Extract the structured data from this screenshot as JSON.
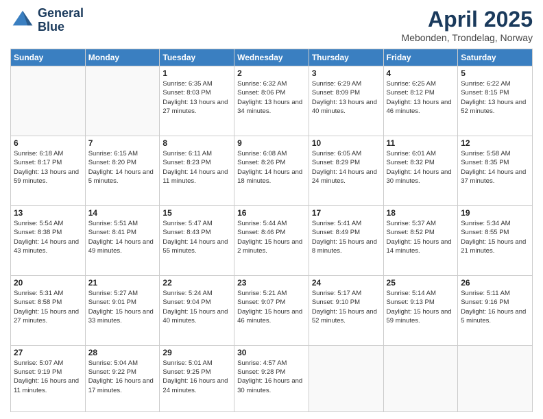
{
  "header": {
    "logo_line1": "General",
    "logo_line2": "Blue",
    "title": "April 2025",
    "subtitle": "Mebonden, Trondelag, Norway"
  },
  "days_of_week": [
    "Sunday",
    "Monday",
    "Tuesday",
    "Wednesday",
    "Thursday",
    "Friday",
    "Saturday"
  ],
  "weeks": [
    [
      {
        "day": "",
        "info": ""
      },
      {
        "day": "",
        "info": ""
      },
      {
        "day": "1",
        "info": "Sunrise: 6:35 AM\nSunset: 8:03 PM\nDaylight: 13 hours and 27 minutes."
      },
      {
        "day": "2",
        "info": "Sunrise: 6:32 AM\nSunset: 8:06 PM\nDaylight: 13 hours and 34 minutes."
      },
      {
        "day": "3",
        "info": "Sunrise: 6:29 AM\nSunset: 8:09 PM\nDaylight: 13 hours and 40 minutes."
      },
      {
        "day": "4",
        "info": "Sunrise: 6:25 AM\nSunset: 8:12 PM\nDaylight: 13 hours and 46 minutes."
      },
      {
        "day": "5",
        "info": "Sunrise: 6:22 AM\nSunset: 8:15 PM\nDaylight: 13 hours and 52 minutes."
      }
    ],
    [
      {
        "day": "6",
        "info": "Sunrise: 6:18 AM\nSunset: 8:17 PM\nDaylight: 13 hours and 59 minutes."
      },
      {
        "day": "7",
        "info": "Sunrise: 6:15 AM\nSunset: 8:20 PM\nDaylight: 14 hours and 5 minutes."
      },
      {
        "day": "8",
        "info": "Sunrise: 6:11 AM\nSunset: 8:23 PM\nDaylight: 14 hours and 11 minutes."
      },
      {
        "day": "9",
        "info": "Sunrise: 6:08 AM\nSunset: 8:26 PM\nDaylight: 14 hours and 18 minutes."
      },
      {
        "day": "10",
        "info": "Sunrise: 6:05 AM\nSunset: 8:29 PM\nDaylight: 14 hours and 24 minutes."
      },
      {
        "day": "11",
        "info": "Sunrise: 6:01 AM\nSunset: 8:32 PM\nDaylight: 14 hours and 30 minutes."
      },
      {
        "day": "12",
        "info": "Sunrise: 5:58 AM\nSunset: 8:35 PM\nDaylight: 14 hours and 37 minutes."
      }
    ],
    [
      {
        "day": "13",
        "info": "Sunrise: 5:54 AM\nSunset: 8:38 PM\nDaylight: 14 hours and 43 minutes."
      },
      {
        "day": "14",
        "info": "Sunrise: 5:51 AM\nSunset: 8:41 PM\nDaylight: 14 hours and 49 minutes."
      },
      {
        "day": "15",
        "info": "Sunrise: 5:47 AM\nSunset: 8:43 PM\nDaylight: 14 hours and 55 minutes."
      },
      {
        "day": "16",
        "info": "Sunrise: 5:44 AM\nSunset: 8:46 PM\nDaylight: 15 hours and 2 minutes."
      },
      {
        "day": "17",
        "info": "Sunrise: 5:41 AM\nSunset: 8:49 PM\nDaylight: 15 hours and 8 minutes."
      },
      {
        "day": "18",
        "info": "Sunrise: 5:37 AM\nSunset: 8:52 PM\nDaylight: 15 hours and 14 minutes."
      },
      {
        "day": "19",
        "info": "Sunrise: 5:34 AM\nSunset: 8:55 PM\nDaylight: 15 hours and 21 minutes."
      }
    ],
    [
      {
        "day": "20",
        "info": "Sunrise: 5:31 AM\nSunset: 8:58 PM\nDaylight: 15 hours and 27 minutes."
      },
      {
        "day": "21",
        "info": "Sunrise: 5:27 AM\nSunset: 9:01 PM\nDaylight: 15 hours and 33 minutes."
      },
      {
        "day": "22",
        "info": "Sunrise: 5:24 AM\nSunset: 9:04 PM\nDaylight: 15 hours and 40 minutes."
      },
      {
        "day": "23",
        "info": "Sunrise: 5:21 AM\nSunset: 9:07 PM\nDaylight: 15 hours and 46 minutes."
      },
      {
        "day": "24",
        "info": "Sunrise: 5:17 AM\nSunset: 9:10 PM\nDaylight: 15 hours and 52 minutes."
      },
      {
        "day": "25",
        "info": "Sunrise: 5:14 AM\nSunset: 9:13 PM\nDaylight: 15 hours and 59 minutes."
      },
      {
        "day": "26",
        "info": "Sunrise: 5:11 AM\nSunset: 9:16 PM\nDaylight: 16 hours and 5 minutes."
      }
    ],
    [
      {
        "day": "27",
        "info": "Sunrise: 5:07 AM\nSunset: 9:19 PM\nDaylight: 16 hours and 11 minutes."
      },
      {
        "day": "28",
        "info": "Sunrise: 5:04 AM\nSunset: 9:22 PM\nDaylight: 16 hours and 17 minutes."
      },
      {
        "day": "29",
        "info": "Sunrise: 5:01 AM\nSunset: 9:25 PM\nDaylight: 16 hours and 24 minutes."
      },
      {
        "day": "30",
        "info": "Sunrise: 4:57 AM\nSunset: 9:28 PM\nDaylight: 16 hours and 30 minutes."
      },
      {
        "day": "",
        "info": ""
      },
      {
        "day": "",
        "info": ""
      },
      {
        "day": "",
        "info": ""
      }
    ]
  ]
}
